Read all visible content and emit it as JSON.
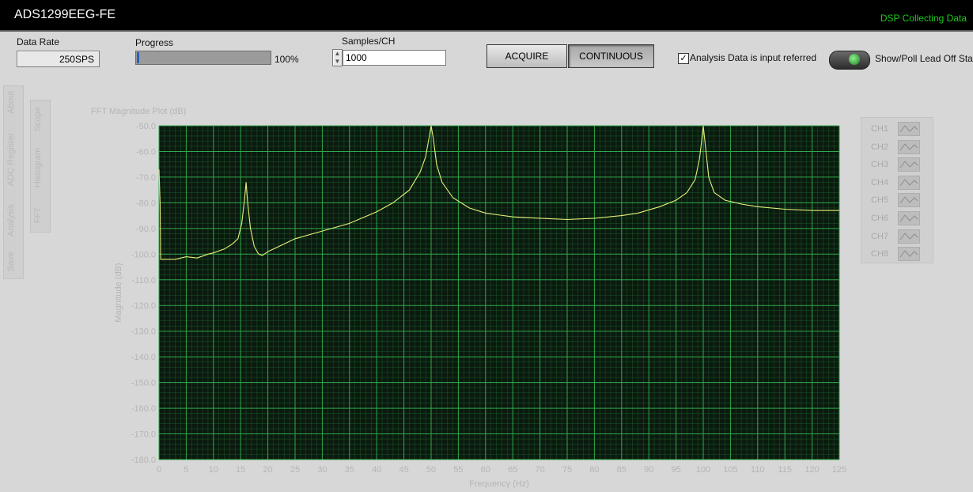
{
  "window": {
    "title": "ADS1299EEG-FE",
    "status": "DSP Collecting Data",
    "status_color": "#1ec81e"
  },
  "controls": {
    "data_rate": {
      "label": "Data Rate",
      "value": "250SPS"
    },
    "progress": {
      "label": "Progress",
      "value_text": "100%",
      "fraction": 0.02
    },
    "samples": {
      "label": "Samples/CH",
      "value": "1000"
    },
    "acquire_label": "ACQUIRE",
    "continuous_label": "CONTINUOUS",
    "analysis_checkbox": {
      "label": "Analysis Data is input referred",
      "checked": true
    },
    "lead_off_label": "Show/Poll Lead Off Stat"
  },
  "left_tabs": [
    "About",
    "ADC Register",
    "Analysis",
    "Save"
  ],
  "sub_tabs": [
    "Scope",
    "Histogram",
    "FFT"
  ],
  "legend": [
    "CH1",
    "CH2",
    "CH3",
    "CH4",
    "CH5",
    "CH6",
    "CH7",
    "CH8"
  ],
  "chart_data": {
    "type": "line",
    "title": "FFT Magnitude Plot (dB)",
    "xlabel": "Frequency (Hz)",
    "ylabel": "Magnitude (dB)",
    "xlim": [
      0,
      125
    ],
    "ylim": [
      -180,
      -50
    ],
    "xticks": [
      0,
      5,
      10,
      15,
      20,
      25,
      30,
      35,
      40,
      45,
      50,
      55,
      60,
      65,
      70,
      75,
      80,
      85,
      90,
      95,
      100,
      105,
      110,
      115,
      120,
      125
    ],
    "yticks": [
      -50,
      -60,
      -70,
      -80,
      -90,
      -100,
      -110,
      -120,
      -130,
      -140,
      -150,
      -160,
      -170,
      -180
    ],
    "grid": true,
    "background": "#0b1a0f",
    "grid_color": "#2fa84a",
    "line_color": "#e6f07a",
    "series": [
      {
        "name": "CH1",
        "x": [
          0,
          0.2,
          0.3,
          1,
          3,
          5,
          7,
          9,
          10,
          12,
          13.5,
          14.5,
          15.2,
          15.7,
          16,
          16.3,
          16.8,
          17.5,
          18.3,
          19,
          20,
          22,
          25,
          30,
          35,
          40,
          43,
          46,
          48,
          49,
          49.6,
          50,
          50.4,
          51,
          52,
          54,
          57,
          60,
          65,
          70,
          75,
          80,
          85,
          88,
          92,
          95,
          97,
          98.5,
          99.3,
          99.6,
          100,
          100.4,
          101,
          102,
          104,
          107,
          110,
          115,
          120,
          125
        ],
        "y": [
          -67,
          -80,
          -102,
          -102,
          -102,
          -101,
          -101.5,
          -100,
          -99.5,
          -98,
          -96,
          -94,
          -88,
          -79,
          -72,
          -80,
          -90,
          -97,
          -100,
          -100.5,
          -99,
          -97,
          -94,
          -91,
          -88,
          -83.5,
          -80,
          -75,
          -68,
          -62,
          -55,
          -50,
          -55,
          -65,
          -72,
          -78,
          -82,
          -84,
          -85.5,
          -86,
          -86.5,
          -86,
          -85,
          -84,
          -81.5,
          -79,
          -76,
          -71,
          -63,
          -58,
          -50,
          -58,
          -70,
          -76,
          -79,
          -80.5,
          -81.5,
          -82.5,
          -83,
          -83
        ]
      }
    ]
  }
}
